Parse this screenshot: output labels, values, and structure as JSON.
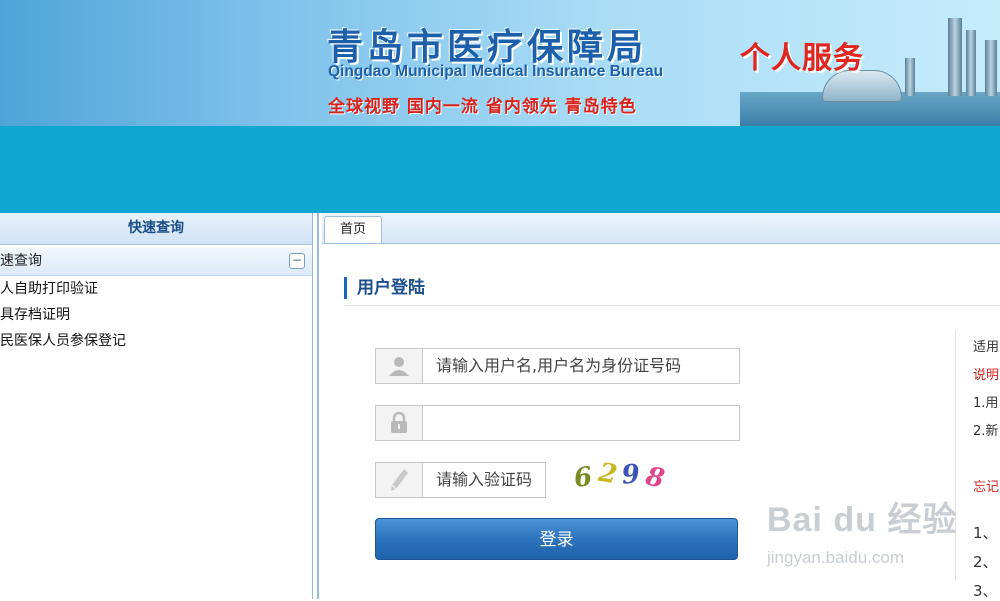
{
  "header": {
    "title_cn": "青岛市医疗保障局",
    "title_en": "Qingdao Municipal Medical Insurance Bureau",
    "slogan": "全球视野 国内一流 省内领先 青岛特色",
    "service_label": "个人服务"
  },
  "sidebar": {
    "header": "快速查询",
    "group_label": "速查询",
    "collapse_symbol": "−",
    "items": [
      {
        "label": "人自助打印验证"
      },
      {
        "label": "具存档证明"
      },
      {
        "label": "民医保人员参保登记"
      }
    ]
  },
  "tabs": [
    {
      "label": "首页"
    }
  ],
  "login": {
    "section_title": "用户登陆",
    "username_placeholder": "请输入用户名,用户名为身份证号码",
    "password_value": "",
    "captcha_placeholder": "请输入验证码",
    "captcha_chars": [
      "6",
      "2",
      "9",
      "8"
    ],
    "captcha_colors": [
      "#7b8a22",
      "#c9b81f",
      "#3a55b8",
      "#e0448a"
    ],
    "submit_label": "登录"
  },
  "info_panel": {
    "line1": "适用",
    "line2": "说明",
    "line3": "1.用",
    "line4": "2.新",
    "line5": "忘记",
    "line6": "1、",
    "line7": "2、",
    "line8": "3、"
  },
  "watermark": {
    "main": "Bai du 经验",
    "sub": "jingyan.baidu.com"
  },
  "colors": {
    "accent_blue": "#1b66b5",
    "band_teal": "#0fa6cf",
    "alert_red": "#d8231d"
  }
}
